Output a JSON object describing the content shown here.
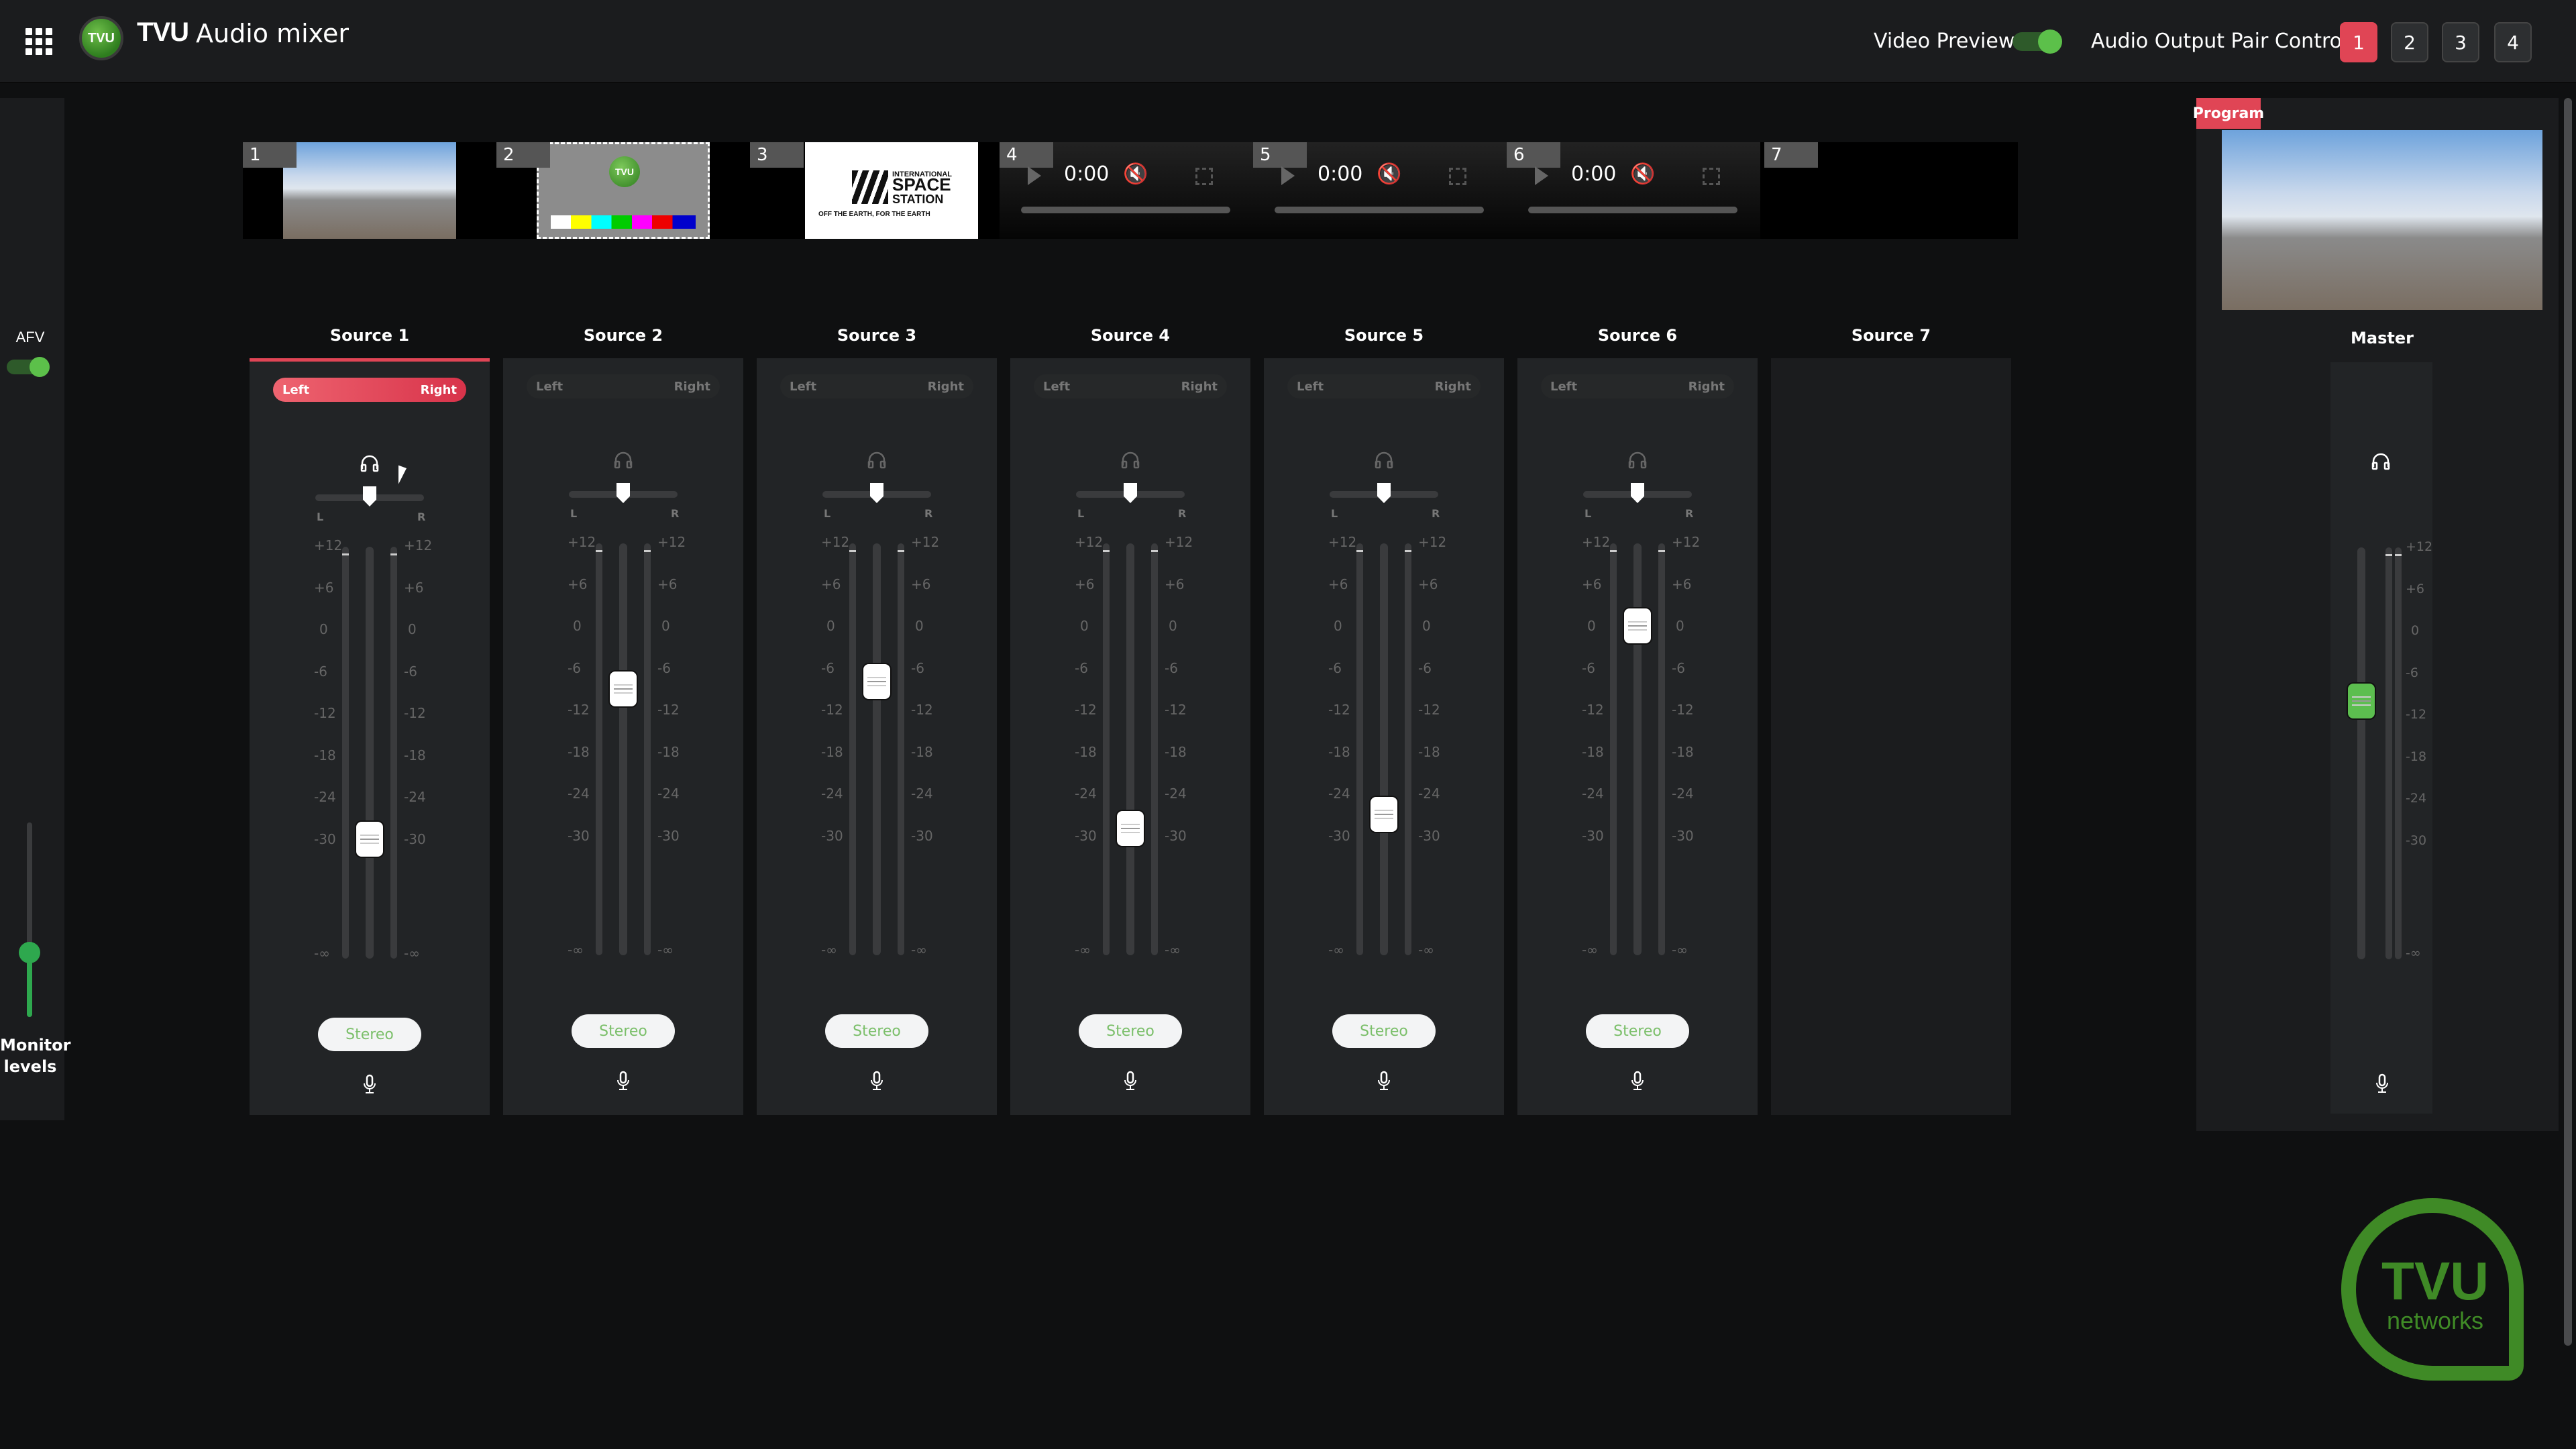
{
  "header": {
    "brand": "TVU",
    "title": "Audio mixer",
    "logo_text": "TVU",
    "video_preview_label": "Video Preview",
    "video_preview_on": true,
    "audio_output_label": "Audio Output Pair Control",
    "pair_buttons": [
      "1",
      "2",
      "3",
      "4"
    ],
    "active_pair": "1",
    "accent_color": "#e04555",
    "toggle_color": "#5cc04a"
  },
  "left_rail": {
    "afv_label": "AFV",
    "afv_on": true,
    "monitor_label_line1": "Monitor",
    "monitor_label_line2": "levels",
    "monitor_level_percent": 33
  },
  "previews": [
    {
      "num": "1",
      "kind": "image",
      "content": "gannet-colony"
    },
    {
      "num": "2",
      "kind": "image",
      "content": "test-pattern",
      "logo_text": "TVU"
    },
    {
      "num": "3",
      "kind": "image",
      "content": "iss-logo",
      "line1": "INTERNATIONAL",
      "line2": "SPACE",
      "line3": "STATION",
      "tagline": "OFF THE EARTH, FOR THE EARTH"
    },
    {
      "num": "4",
      "kind": "player",
      "time": "0:00"
    },
    {
      "num": "5",
      "kind": "player",
      "time": "0:00"
    },
    {
      "num": "6",
      "kind": "player",
      "time": "0:00"
    },
    {
      "num": "7",
      "kind": "empty"
    }
  ],
  "scale_labels": [
    "+12",
    "+6",
    "0",
    "-6",
    "-12",
    "-18",
    "-24",
    "-30",
    "-∞"
  ],
  "sources": [
    {
      "title": "Source 1",
      "left": "Left",
      "right": "Right",
      "lr_active": true,
      "selected": true,
      "headphone_active": true,
      "pan": 0.5,
      "fader_db": -30,
      "mode": "Stereo"
    },
    {
      "title": "Source 2",
      "left": "Left",
      "right": "Right",
      "lr_active": false,
      "selected": false,
      "headphone_active": false,
      "pan": 0.5,
      "fader_db": -9,
      "mode": "Stereo"
    },
    {
      "title": "Source 3",
      "left": "Left",
      "right": "Right",
      "lr_active": false,
      "selected": false,
      "headphone_active": false,
      "pan": 0.5,
      "fader_db": -8,
      "mode": "Stereo"
    },
    {
      "title": "Source 4",
      "left": "Left",
      "right": "Right",
      "lr_active": false,
      "selected": false,
      "headphone_active": false,
      "pan": 0.5,
      "fader_db": -29,
      "mode": "Stereo"
    },
    {
      "title": "Source 5",
      "left": "Left",
      "right": "Right",
      "lr_active": false,
      "selected": false,
      "headphone_active": false,
      "pan": 0.5,
      "fader_db": -27,
      "mode": "Stereo"
    },
    {
      "title": "Source 6",
      "left": "Left",
      "right": "Right",
      "lr_active": false,
      "selected": false,
      "headphone_active": false,
      "pan": 0.5,
      "fader_db": 0,
      "mode": "Stereo"
    },
    {
      "title": "Source 7",
      "empty": true
    }
  ],
  "pan_labels": {
    "l": "L",
    "r": "R"
  },
  "program": {
    "badge": "Program",
    "master_title": "Master",
    "master_fader_db": -10
  },
  "footer_logo": {
    "top": "TVU",
    "bottom": "networks"
  }
}
